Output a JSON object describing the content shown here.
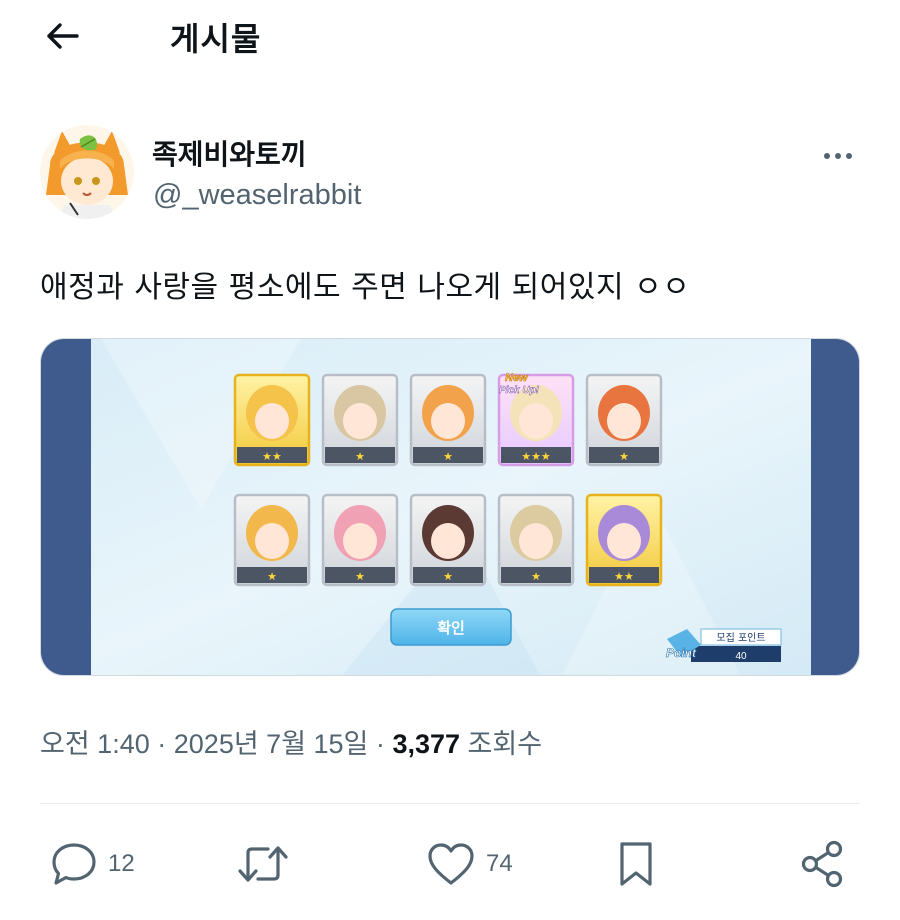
{
  "header": {
    "title": "게시물"
  },
  "author": {
    "display_name": "족제비와토끼",
    "handle": "@_weaselrabbit"
  },
  "post": {
    "text": "애정과 사랑을 평소에도 주면 나오게 되어있지 ㅇㅇ"
  },
  "media": {
    "new_label": "New",
    "pickup_label": "Pick Up!",
    "confirm_label": "확인",
    "points_label": "모집 포인트",
    "points_word": "Point",
    "points_value": "40",
    "cards": [
      {
        "stars": "★★",
        "rarity": "gold"
      },
      {
        "stars": "★",
        "rarity": "silver"
      },
      {
        "stars": "★",
        "rarity": "silver"
      },
      {
        "stars": "★★★",
        "rarity": "pickup"
      },
      {
        "stars": "★",
        "rarity": "silver"
      },
      {
        "stars": "★",
        "rarity": "silver"
      },
      {
        "stars": "★",
        "rarity": "silver"
      },
      {
        "stars": "★",
        "rarity": "silver"
      },
      {
        "stars": "★",
        "rarity": "silver"
      },
      {
        "stars": "★★",
        "rarity": "gold"
      }
    ]
  },
  "meta": {
    "time": "오전 1:40",
    "sep1": "·",
    "date": "2025년 7월 15일",
    "sep2": "·",
    "views_count": "3,377",
    "views_label": "조회수"
  },
  "actions": {
    "reply_count": "12",
    "like_count": "74"
  },
  "colors": {
    "text": "#0f1419",
    "muted": "#536471",
    "accent": "#5aa9e6"
  }
}
